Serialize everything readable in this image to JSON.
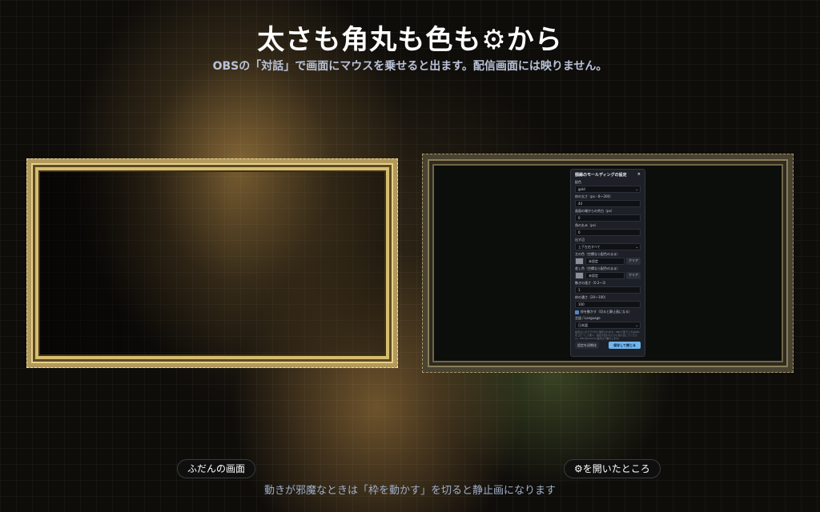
{
  "header": {
    "title": "太さも角丸も色も⚙から",
    "subtitle": "OBSの「対話」で画面にマウスを乗せると出ます。配信画面には映りません。"
  },
  "captions": {
    "left": "ふだんの画面",
    "right": "⚙を開いたところ",
    "footer": "動きが邪魔なときは「枠を動かす」を切ると静止画になります"
  },
  "panel": {
    "title": "額縁のモールディングの設定",
    "close": "×",
    "material_label": "配色",
    "material_value": "gold",
    "thickness_label": "枠の太さ（px・8〜200）",
    "thickness_value": "44",
    "edge_offset_label": "画面の端からの余白（px）",
    "edge_offset_value": "0",
    "radius_label": "角の丸み（px）",
    "radius_value": "0",
    "sides_label": "出す辺",
    "sides_value": "上下左右すべて",
    "color1_label": "主の色（空欄なら配色のまま）",
    "color1_placeholder": "未設定",
    "color2_label": "差し色（空欄なら配色のまま）",
    "color2_placeholder": "未設定",
    "color_button": "クリア",
    "speed_label": "動きの速さ（0.2〜3）",
    "speed_value": "1",
    "opacity_label": "枠の濃さ（20〜100）",
    "opacity_value": "100",
    "animate_label": "枠を動かす（切ると静止画になる）",
    "language_label": "言語 / Language",
    "language_value": "日本語",
    "note": "設定はこのブラウザに保存されます。OBSで使うときはURLをコピーして使い、設定が変わるたびに貼り直してください。URLのparams 設定は下書きします。",
    "reset_button": "設定を初期化",
    "save_button": "保存して閉じる"
  },
  "colors": {
    "accent_gold": "#d7bd6e",
    "save_button": "#6fb6f0"
  }
}
